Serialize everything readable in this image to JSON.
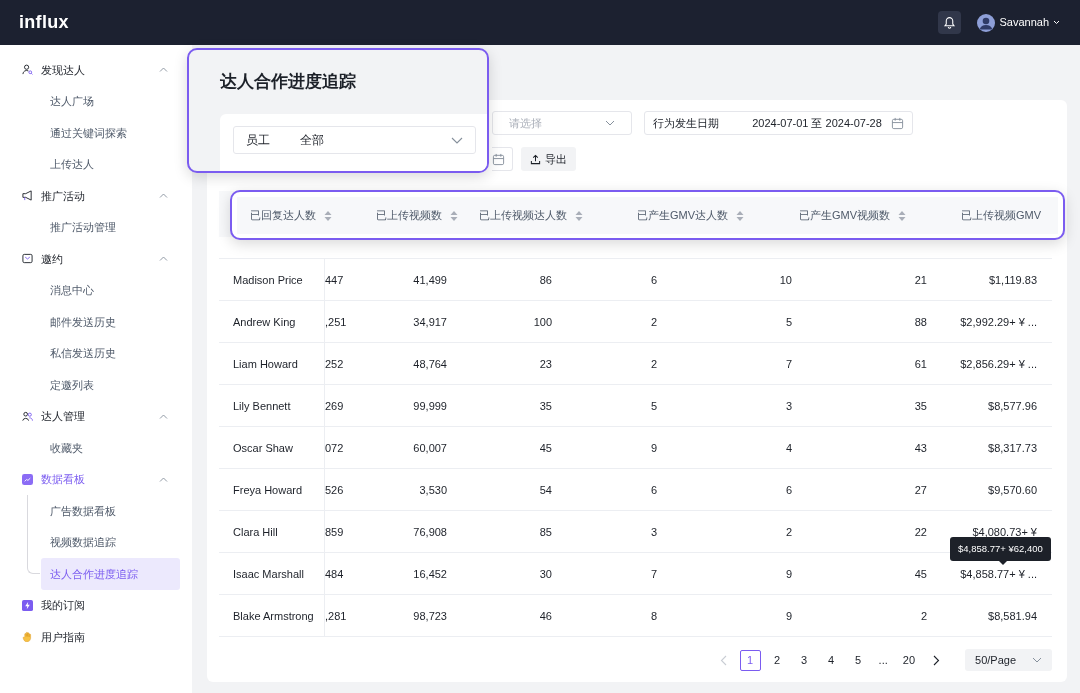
{
  "brand": "influx",
  "user": {
    "name": "Savannah"
  },
  "sidebar": [
    {
      "label": "发现达人",
      "active": false,
      "expanded": true,
      "children": [
        {
          "label": "达人广场",
          "selected": false
        },
        {
          "label": "通过关键词探索",
          "selected": false
        },
        {
          "label": "上传达人",
          "selected": false
        }
      ]
    },
    {
      "label": "推广活动",
      "active": false,
      "expanded": true,
      "children": [
        {
          "label": "推广活动管理",
          "selected": false
        }
      ]
    },
    {
      "label": "邀约",
      "active": false,
      "expanded": true,
      "children": [
        {
          "label": "消息中心",
          "selected": false
        },
        {
          "label": "邮件发送历史",
          "selected": false
        },
        {
          "label": "私信发送历史",
          "selected": false
        },
        {
          "label": "定邀列表",
          "selected": false
        }
      ]
    },
    {
      "label": "达人管理",
      "active": false,
      "expanded": true,
      "children": [
        {
          "label": "收藏夹",
          "selected": false
        }
      ]
    },
    {
      "label": "数据看板",
      "active": true,
      "expanded": true,
      "children": [
        {
          "label": "广告数据看板",
          "selected": false
        },
        {
          "label": "视频数据追踪",
          "selected": false
        },
        {
          "label": "达人合作进度追踪",
          "selected": true
        }
      ]
    },
    {
      "label": "我的订阅",
      "active": false
    },
    {
      "label": "用户指南",
      "active": false
    }
  ],
  "page_title": "达人合作进度追踪",
  "staff_filter": {
    "label": "员工",
    "value": "全部"
  },
  "filters": {
    "select": {
      "placeholder": "请选择"
    },
    "date": {
      "label": "行为发生日期",
      "value": "2024-07-01 至 2024-07-28"
    },
    "export": "导出"
  },
  "columns": [
    "已回复达人数",
    "已上传视频数",
    "已上传视频达人数",
    "已产生GMV达人数",
    "已产生GMV视频数",
    "已上传视频GMV"
  ],
  "rows": [
    {
      "name": "Madison Price",
      "values": [
        "447",
        "41,499",
        "86",
        "6",
        "10",
        "21",
        "$1,119.83"
      ]
    },
    {
      "name": "Andrew King",
      "values": [
        ",251",
        "34,917",
        "100",
        "2",
        "5",
        "88",
        "$2,992.29+ ¥ ..."
      ]
    },
    {
      "name": "Liam Howard",
      "values": [
        "252",
        "48,764",
        "23",
        "2",
        "7",
        "61",
        "$2,856.29+ ¥ ..."
      ]
    },
    {
      "name": "Lily Bennett",
      "values": [
        "269",
        "99,999",
        "35",
        "5",
        "3",
        "35",
        "$8,577.96"
      ]
    },
    {
      "name": "Oscar Shaw",
      "values": [
        "072",
        "60,007",
        "45",
        "9",
        "4",
        "43",
        "$8,317.73"
      ]
    },
    {
      "name": "Freya Howard",
      "values": [
        "526",
        "3,530",
        "54",
        "6",
        "6",
        "27",
        "$9,570.60"
      ]
    },
    {
      "name": "Clara Hill",
      "values": [
        "859",
        "76,908",
        "85",
        "3",
        "2",
        "22",
        "$4,080.73+ ¥"
      ]
    },
    {
      "name": "Isaac Marshall",
      "values": [
        "484",
        "16,452",
        "30",
        "7",
        "9",
        "45",
        "$4,858.77+ ¥ ..."
      ],
      "tooltip": "$4,858.77+ ¥62,400"
    },
    {
      "name": "Blake Armstrong",
      "values": [
        ",281",
        "98,723",
        "46",
        "8",
        "9",
        "2",
        "$8,581.94"
      ]
    }
  ],
  "pagination": {
    "previous": {
      "disabled": true
    },
    "next": {
      "disabled": false
    },
    "pages": [
      {
        "label": "1",
        "selected": true
      },
      {
        "label": "2",
        "selected": false
      },
      {
        "label": "3",
        "selected": false
      },
      {
        "label": "4",
        "selected": false
      },
      {
        "label": "5",
        "selected": false
      },
      {
        "label": "...",
        "kind": "ellipsis"
      },
      {
        "label": "20",
        "selected": false
      }
    ],
    "page_size": "50/Page"
  }
}
